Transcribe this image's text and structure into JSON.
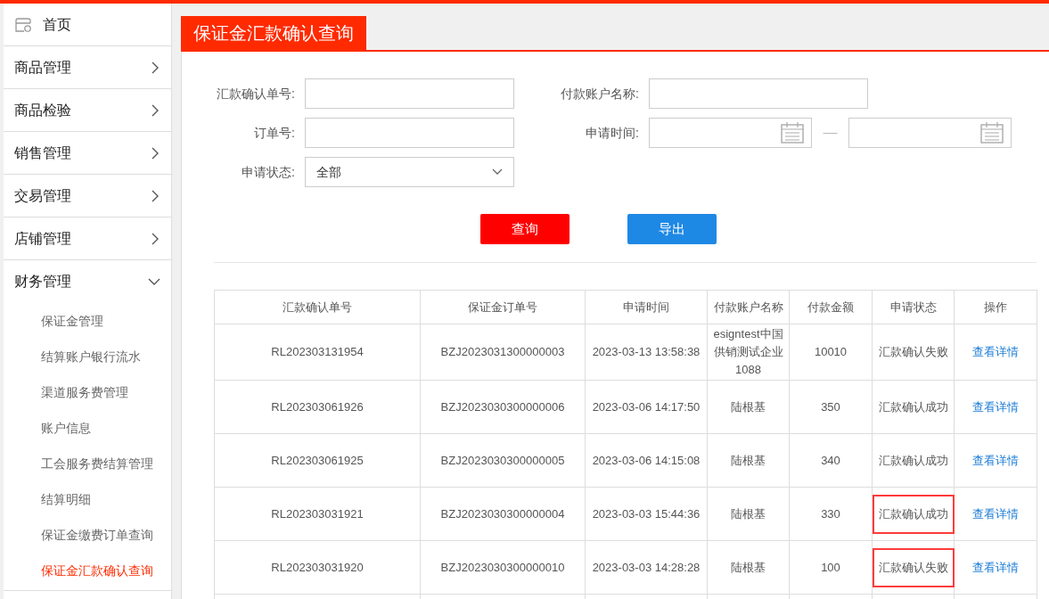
{
  "sidebar": {
    "home": "首页",
    "items": [
      {
        "label": "商品管理",
        "expanded": false
      },
      {
        "label": "商品检验",
        "expanded": false
      },
      {
        "label": "销售管理",
        "expanded": false
      },
      {
        "label": "交易管理",
        "expanded": false
      },
      {
        "label": "店铺管理",
        "expanded": false
      },
      {
        "label": "财务管理",
        "expanded": true,
        "children": [
          {
            "label": "保证金管理",
            "selected": false
          },
          {
            "label": "结算账户银行流水",
            "selected": false
          },
          {
            "label": "渠道服务费管理",
            "selected": false
          },
          {
            "label": "账户信息",
            "selected": false
          },
          {
            "label": "工会服务费结算管理",
            "selected": false
          },
          {
            "label": "结算明细",
            "selected": false
          },
          {
            "label": "保证金缴费订单查询",
            "selected": false
          },
          {
            "label": "保证金汇款确认查询",
            "selected": true
          }
        ]
      }
    ]
  },
  "page_title": "保证金汇款确认查询",
  "form": {
    "remit_no": {
      "label": "汇款确认单号:"
    },
    "payer_name": {
      "label": "付款账户名称:"
    },
    "order_no": {
      "label": "订单号:"
    },
    "apply_time": {
      "label": "申请时间:",
      "separator": "—"
    },
    "status": {
      "label": "申请状态:",
      "value": "全部"
    }
  },
  "buttons": {
    "query": "查询",
    "export": "导出"
  },
  "table": {
    "columns": [
      "汇款确认单号",
      "保证金订单号",
      "申请时间",
      "付款账户名称",
      "付款金额",
      "申请状态",
      "操作"
    ],
    "rows": [
      {
        "cells": [
          "RL202303131954",
          "BZJ2023031300000003",
          "2023-03-13 13:58:38",
          "esigntest中国供销测试企业1088",
          "10010",
          "汇款确认失败"
        ],
        "action": "查看详情",
        "highlighted": false
      },
      {
        "cells": [
          "RL202303061926",
          "BZJ2023030300000006",
          "2023-03-06 14:17:50",
          "陆根基",
          "350",
          "汇款确认成功"
        ],
        "action": "查看详情",
        "highlighted": false
      },
      {
        "cells": [
          "RL202303061925",
          "BZJ2023030300000005",
          "2023-03-06 14:15:08",
          "陆根基",
          "340",
          "汇款确认成功"
        ],
        "action": "查看详情",
        "highlighted": false
      },
      {
        "cells": [
          "RL202303031921",
          "BZJ2023030300000004",
          "2023-03-03 15:44:36",
          "陆根基",
          "330",
          "汇款确认成功"
        ],
        "action": "查看详情",
        "highlighted": true
      },
      {
        "cells": [
          "RL202303031920",
          "BZJ2023030300000010",
          "2023-03-03 14:28:28",
          "陆根基",
          "100",
          "汇款确认失败"
        ],
        "action": "查看详情",
        "highlighted": true
      }
    ]
  }
}
